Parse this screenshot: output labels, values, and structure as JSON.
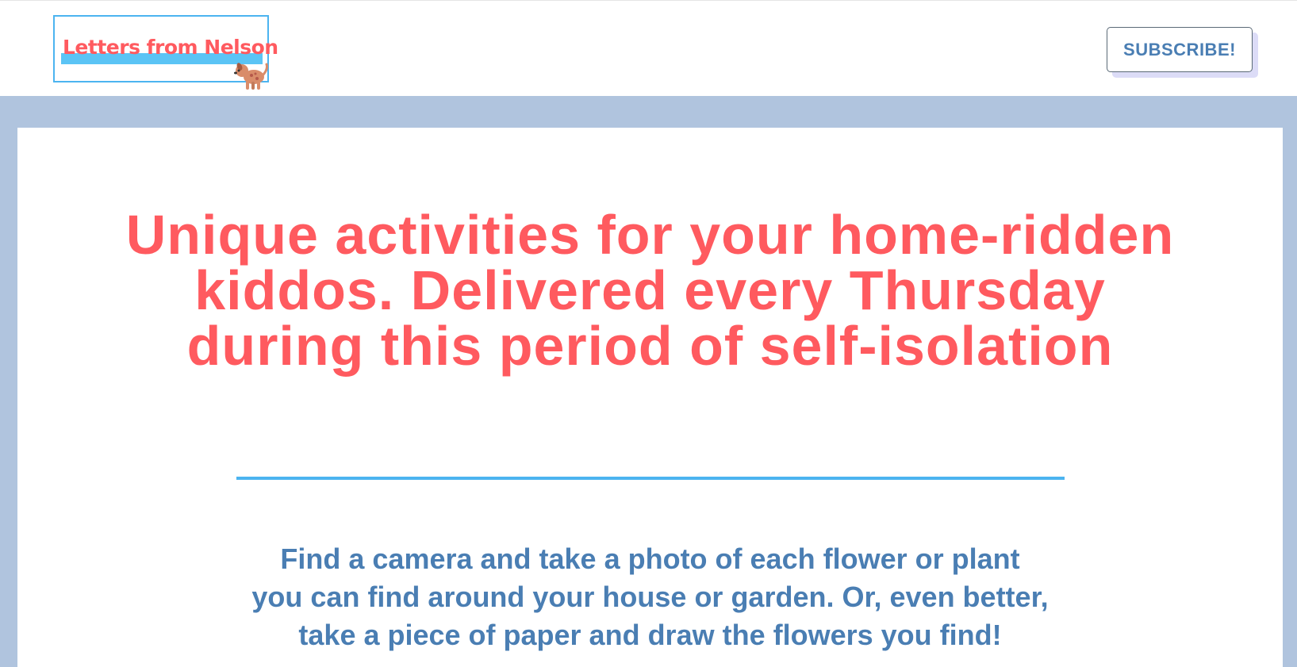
{
  "header": {
    "logo_text": "Letters from Nelson",
    "logo_icon": "dog-icon",
    "subscribe_label": "SUBSCRIBE!"
  },
  "main": {
    "headline": "Unique activities for your home-ridden kiddos. Delivered every Thursday during this period of self-isolation",
    "activity_text": "Find a camera and take a photo of each flower or plant you can find around your house or garden. Or, even better, take a piece of paper and draw the flowers you find!"
  },
  "colors": {
    "accent_red": "#ff5a5f",
    "accent_blue": "#4cb4f0",
    "text_blue": "#4a7eb3",
    "frame_background": "#b0c4de"
  }
}
